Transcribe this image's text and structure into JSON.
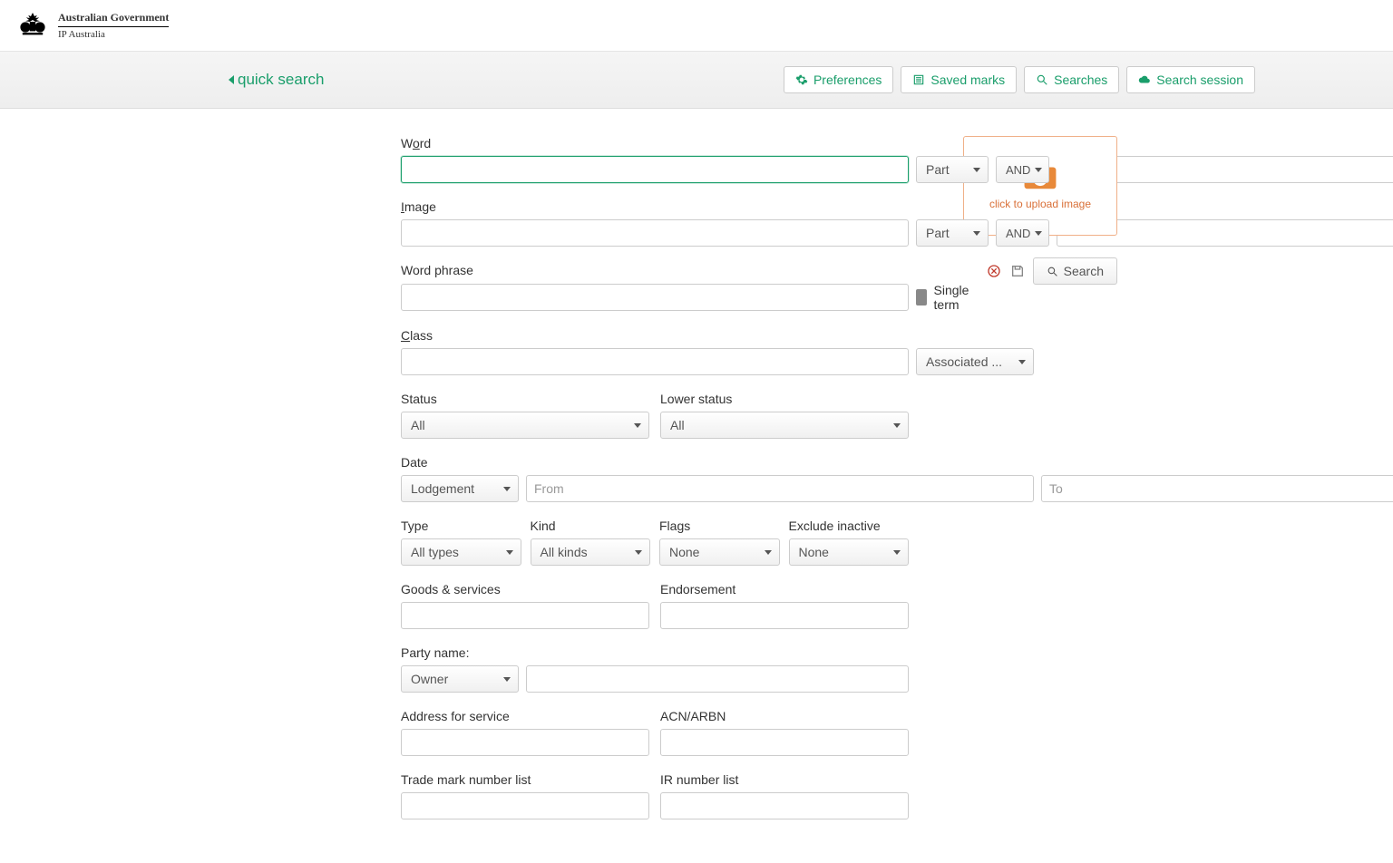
{
  "header": {
    "gov": "Australian Government",
    "org": "IP Australia"
  },
  "subnav": {
    "quick_search": "quick search",
    "preferences": "Preferences",
    "saved_marks": "Saved marks",
    "searches": "Searches",
    "search_session": "Search session"
  },
  "form": {
    "word": {
      "label_pre": "W",
      "label_u": "o",
      "label_post": "rd",
      "part": "Part",
      "op": "AND"
    },
    "image": {
      "label_u": "I",
      "label_post": "mage",
      "part": "Part",
      "op": "AND"
    },
    "word_phrase": {
      "label": "Word phrase",
      "single_term": "Single term"
    },
    "class": {
      "label_u": "C",
      "label_post": "lass",
      "associated": "Associated ..."
    },
    "status": {
      "label": "Status",
      "value": "All"
    },
    "lower_status": {
      "label": "Lower status",
      "value": "All"
    },
    "date": {
      "label": "Date",
      "type": "Lodgement",
      "from_ph": "From",
      "to_ph": "To"
    },
    "type": {
      "label": "Type",
      "value": "All types"
    },
    "kind": {
      "label": "Kind",
      "value": "All kinds"
    },
    "flags": {
      "label": "Flags",
      "value": "None"
    },
    "exclude_inactive": {
      "label": "Exclude inactive",
      "value": "None"
    },
    "goods_services": {
      "label": "Goods & services"
    },
    "endorsement": {
      "label": "Endorsement"
    },
    "party_name": {
      "label": "Party name:",
      "type": "Owner"
    },
    "address_service": {
      "label": "Address for service"
    },
    "acn_arbn": {
      "label": "ACN/ARBN"
    },
    "tm_number_list": {
      "label": "Trade mark number list"
    },
    "ir_number_list": {
      "label": "IR number list"
    }
  },
  "side": {
    "upload_caption": "click to upload image",
    "search": "Search"
  }
}
